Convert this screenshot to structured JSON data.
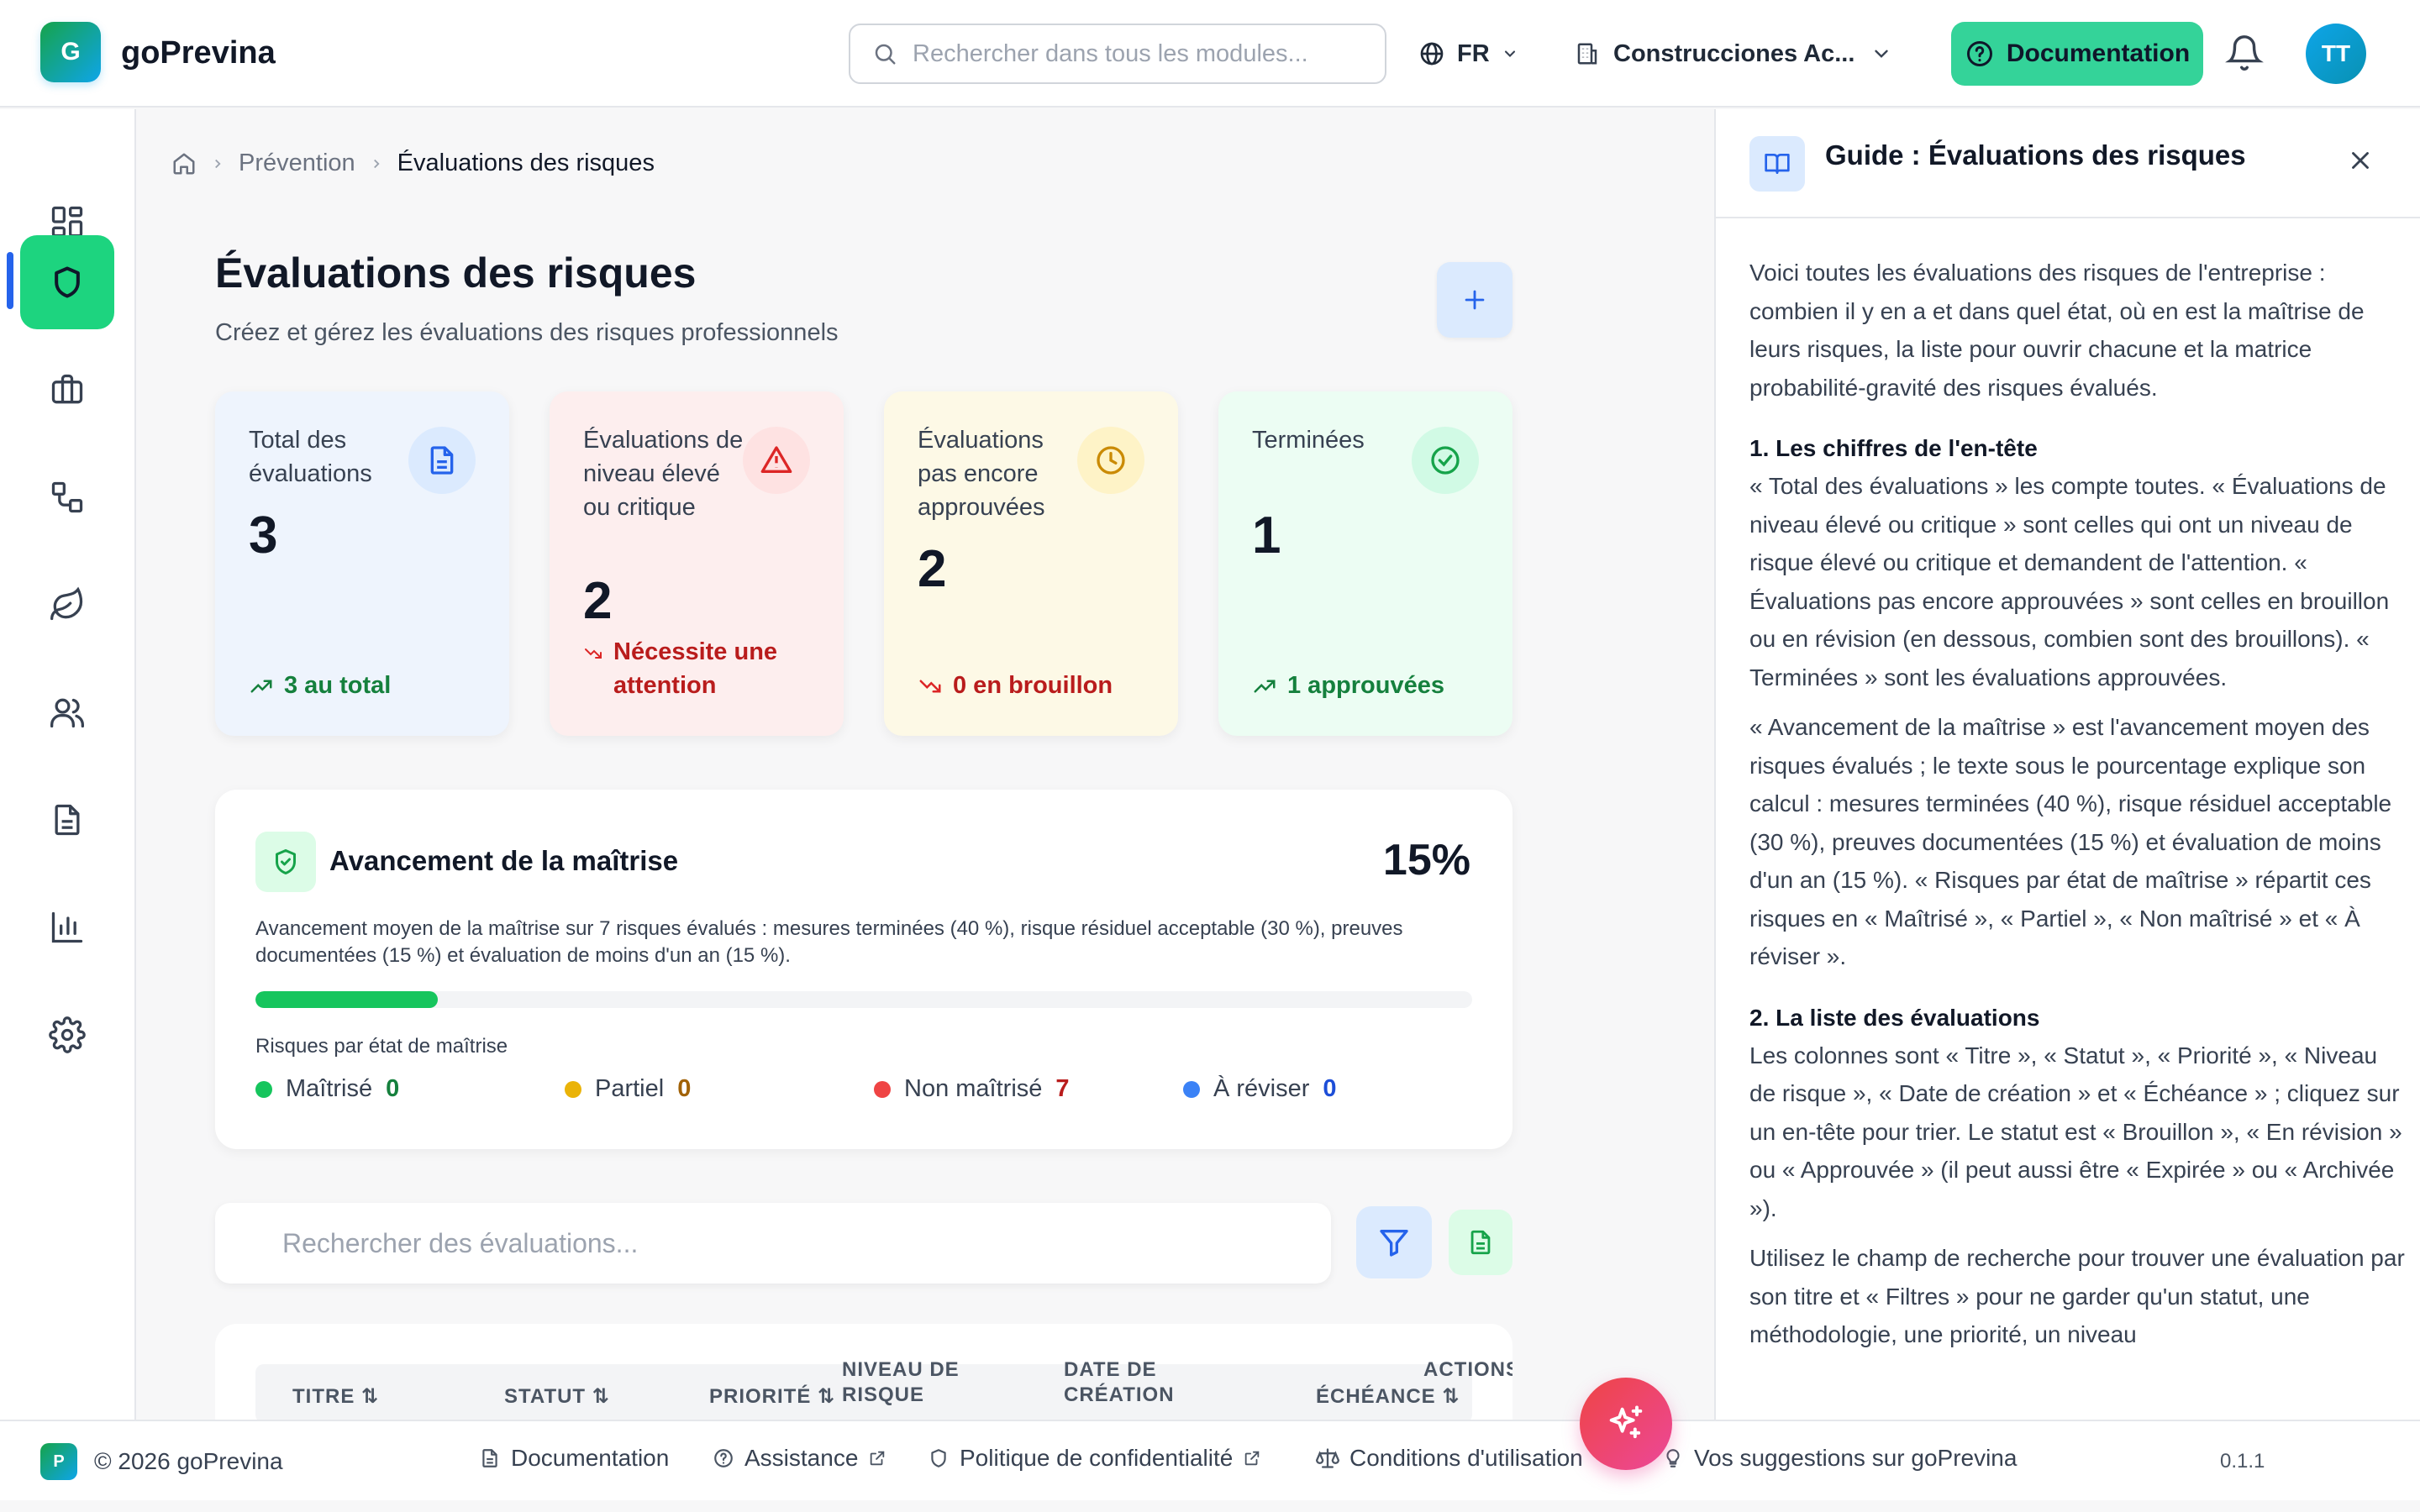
{
  "header": {
    "logo_letter": "G",
    "app_name": "goPrevina",
    "search_placeholder": "Rechercher dans tous les modules...",
    "language": "FR",
    "company": "Construcciones Ac...",
    "documentation_label": "Documentation",
    "avatar_initials": "TT"
  },
  "sidebar": {
    "items": [
      {
        "icon": "dashboard-icon",
        "active": false
      },
      {
        "icon": "shield-icon",
        "active": true
      },
      {
        "icon": "briefcase-icon",
        "active": false
      },
      {
        "icon": "workflow-icon",
        "active": false
      },
      {
        "icon": "leaf-icon",
        "active": false
      },
      {
        "icon": "users-icon",
        "active": false
      },
      {
        "icon": "document-icon",
        "active": false
      },
      {
        "icon": "bar-chart-icon",
        "active": false
      },
      {
        "icon": "settings-icon",
        "active": false
      }
    ]
  },
  "breadcrumb": {
    "home_icon": "home-icon",
    "items": [
      "Prévention",
      "Évaluations des risques"
    ]
  },
  "page": {
    "title": "Évaluations des risques",
    "subtitle": "Créez et gérez les évaluations des risques professionnels"
  },
  "stats": [
    {
      "label": "Total des évaluations",
      "value": "3",
      "footer": "3 au total",
      "trend": "up",
      "bg": "#eef4fd",
      "icon_bg": "#dbeafe",
      "accent": "#2563eb",
      "footer_color": "#15803d"
    },
    {
      "label": "Évaluations de niveau élevé ou critique",
      "value": "2",
      "footer": "Nécessite une attention",
      "trend": "down",
      "bg": "#fdeeee",
      "icon_bg": "#fee2e2",
      "accent": "#dc2626",
      "footer_color": "#b91c1c"
    },
    {
      "label": "Évaluations pas encore approuvées",
      "value": "2",
      "footer": "0 en brouillon",
      "trend": "down",
      "bg": "#fdf9e6",
      "icon_bg": "#fef3c7",
      "accent": "#ca8a04",
      "footer_color": "#b91c1c"
    },
    {
      "label": "Terminées",
      "value": "1",
      "footer": "1 approuvées",
      "trend": "up",
      "bg": "#ecfdf3",
      "icon_bg": "#d1fae5",
      "accent": "#16a34a",
      "footer_color": "#15803d"
    }
  ],
  "mastery": {
    "title": "Avancement de la maîtrise",
    "percent_label": "15%",
    "percent": 15,
    "description": "Avancement moyen de la maîtrise sur 7 risques évalués : mesures terminées (40 %), risque résiduel acceptable (30 %), preuves documentées (15 %) et évaluation de moins d'un an (15 %).",
    "subtitle": "Risques par état de maîtrise",
    "legend": [
      {
        "label": "Maîtrisé",
        "count": "0",
        "color": "#16c55d",
        "count_color": "#15803d"
      },
      {
        "label": "Partiel",
        "count": "0",
        "color": "#eab308",
        "count_color": "#a16207"
      },
      {
        "label": "Non maîtrisé",
        "count": "7",
        "color": "#ef4444",
        "count_color": "#b91c1c"
      },
      {
        "label": "À réviser",
        "count": "0",
        "color": "#3b82f6",
        "count_color": "#1d4ed8"
      }
    ]
  },
  "list": {
    "search_placeholder": "Rechercher des évaluations...",
    "columns": [
      "TITRE",
      "STATUT",
      "PRIORITÉ",
      "NIVEAU DE RISQUE",
      "DATE DE CRÉATION",
      "ÉCHÉANCE",
      "ACTIONS"
    ]
  },
  "guide": {
    "title": "Guide : Évaluations des risques",
    "intro": "Voici toutes les évaluations des risques de l'entreprise : combien il y en a et dans quel état, où en est la maîtrise de leurs risques, la liste pour ouvrir chacune et la matrice probabilité-gravité des risques évalués.",
    "section1_title": "1. Les chiffres de l'en-tête",
    "section1_p1": "« Total des évaluations » les compte toutes. « Évaluations de niveau élevé ou critique » sont celles qui ont un niveau de risque élevé ou critique et demandent de l'attention. « Évaluations pas encore approuvées » sont celles en brouillon ou en révision (en dessous, combien sont des brouillons). « Terminées » sont les évaluations approuvées.",
    "section1_p2": "« Avancement de la maîtrise » est l'avancement moyen des risques évalués ; le texte sous le pourcentage explique son calcul : mesures terminées (40 %), risque résiduel acceptable (30 %), preuves documentées (15 %) et évaluation de moins d'un an (15 %). « Risques par état de maîtrise » répartit ces risques en « Maîtrisé », « Partiel », « Non maîtrisé » et « À réviser ».",
    "section2_title": "2. La liste des évaluations",
    "section2_p1": "Les colonnes sont « Titre », « Statut », « Priorité », « Niveau de risque », « Date de création » et « Échéance » ; cliquez sur un en-tête pour trier. Le statut est « Brouillon », « En révision » ou « Approuvée » (il peut aussi être « Expirée » ou « Archivée »).",
    "section2_p2": "Utilisez le champ de recherche pour trouver une évaluation par son titre et « Filtres » pour ne garder qu'un statut, une méthodologie, une priorité, un niveau"
  },
  "footer": {
    "logo_letter": "P",
    "copyright": "© 2026 goPrevina",
    "links": [
      "Documentation",
      "Assistance",
      "Politique de confidentialité",
      "Conditions d'utilisation",
      "Vos suggestions sur goPrevina"
    ],
    "version": "0.1.1"
  }
}
